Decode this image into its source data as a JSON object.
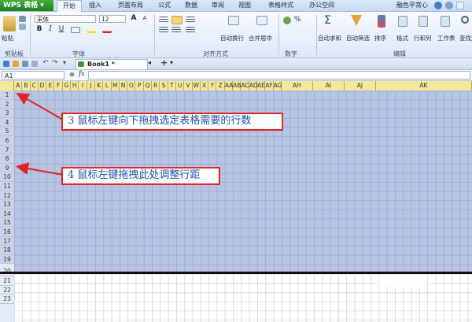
{
  "app": {
    "name": "WPS 表格"
  },
  "menu": {
    "tabs": [
      "开始",
      "插入",
      "页面布局",
      "公式",
      "数据",
      "审阅",
      "视图",
      "表格样式",
      "办公空间"
    ],
    "active_tab": "开始",
    "right_text": "融色平常心"
  },
  "ribbon": {
    "clipboard": {
      "paste": "粘贴",
      "group": "剪贴板"
    },
    "font": {
      "name": "宋体",
      "size": "12",
      "bold": "B",
      "italic": "I",
      "underline": "U",
      "grow": "A",
      "shrink": "A",
      "group": "字体"
    },
    "align": {
      "wrap": "自动换行",
      "merge": "合并居中",
      "group": "对齐方式"
    },
    "number": {
      "percent": "%",
      "group": "数字"
    },
    "edit": {
      "autosum": "自动求和",
      "filter": "自动筛选",
      "sort": "排序",
      "format": "格式",
      "rowcol": "行和列",
      "sheet": "工作表",
      "find": "查找选",
      "group": "编辑"
    }
  },
  "tabrow": {
    "book": "Book1 *"
  },
  "formula": {
    "cell": "A1",
    "fx": "fx"
  },
  "grid": {
    "columns": [
      "A",
      "B",
      "C",
      "D",
      "E",
      "F",
      "G",
      "H",
      "I",
      "J",
      "K",
      "L",
      "M",
      "N",
      "O",
      "P",
      "Q",
      "R",
      "S",
      "T",
      "U",
      "V",
      "W",
      "X",
      "Y",
      "Z",
      "AA",
      "AB",
      "AC",
      "AD",
      "AE",
      "AF",
      "AG",
      "AH",
      "AI",
      "AJ",
      "AK"
    ],
    "rows": [
      "1",
      "2",
      "3",
      "4",
      "5",
      "6",
      "7",
      "8",
      "9",
      "10",
      "11",
      "12",
      "13",
      "14",
      "15",
      "16",
      "17",
      "18",
      "19",
      "20",
      "21",
      "22",
      "23"
    ]
  },
  "annotations": {
    "note1": "3  鼠标左键向下拖拽选定表格需要的行数",
    "note2": "4  鼠标左键拖拽此处调整行距"
  },
  "colors": {
    "selection": "#b8c4e4",
    "annotation_border": "#e02424",
    "annotation_text": "#1a4db3",
    "header_yellow": "#f4e99a"
  }
}
